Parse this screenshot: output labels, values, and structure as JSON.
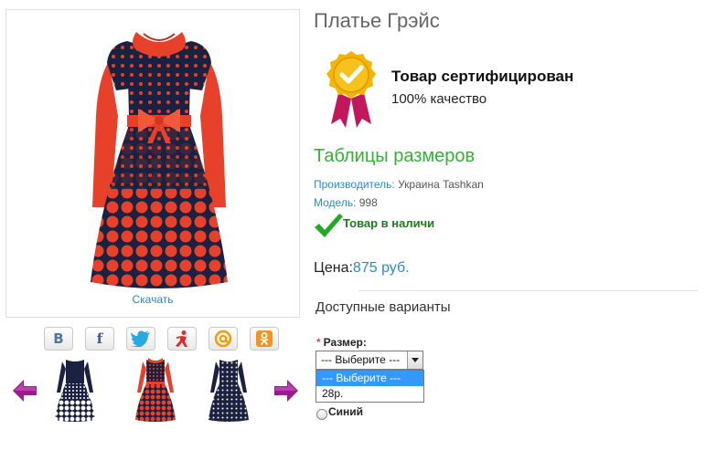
{
  "product": {
    "title": "Платье Грэйс",
    "download_label": "Скачать"
  },
  "social": [
    {
      "icon": "vk-icon",
      "glyph": "В",
      "color": "#4a76a8"
    },
    {
      "icon": "facebook-icon",
      "glyph": "f",
      "color": "#3b5998"
    },
    {
      "icon": "twitter-icon",
      "glyph": "",
      "color": "#2aa9e0"
    },
    {
      "icon": "moikrug-icon",
      "glyph": "",
      "color": "#e02a2a"
    },
    {
      "icon": "mailru-icon",
      "glyph": "@",
      "color": "#f59b00"
    },
    {
      "icon": "odnoklassniki-icon",
      "glyph": "",
      "color": "#f7931e"
    }
  ],
  "certificate": {
    "title": "Товар сертифицирован",
    "subtitle": "100% качество"
  },
  "size_table_label": "Таблицы размеров",
  "info": {
    "manufacturer_label": "Производитель:",
    "manufacturer_value": " Украина Tashkan",
    "model_label": "Модель:",
    "model_value": " 998"
  },
  "stock": {
    "label": "Товар в наличи"
  },
  "price": {
    "label": "Цена:",
    "value": "875 руб."
  },
  "options": {
    "title": "Доступные варианты",
    "size_required_mark": "*",
    "size_label": "Размер:",
    "size_selected": "--- Выберите ---",
    "size_options": [
      "--- Выберите ---",
      "28р."
    ],
    "color_option": "Синий"
  },
  "colors": {
    "accent_blue": "#2b8ac6",
    "green": "#33b233",
    "dress_red": "#e8412b",
    "dress_navy": "#1b2140"
  }
}
